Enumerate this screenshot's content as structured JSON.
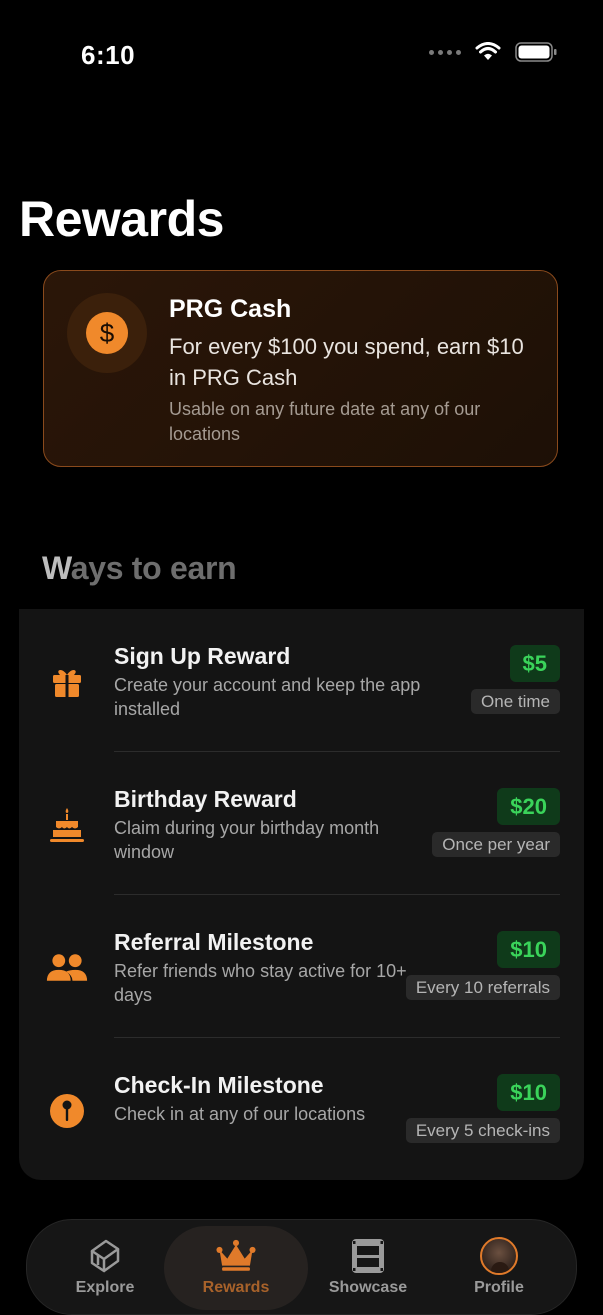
{
  "status_bar": {
    "time": "6:10"
  },
  "page": {
    "title": "Rewards"
  },
  "cash_card": {
    "coin_symbol": "$",
    "title": "PRG Cash",
    "description": "For every $100 you spend, earn $10 in PRG Cash",
    "note": "Usable on any future date at any of our locations"
  },
  "ways_to_earn": {
    "heading_first_letter": "W",
    "heading_rest": "ays to earn",
    "items": [
      {
        "icon": "gift-icon",
        "title": "Sign Up Reward",
        "description": "Create your account and keep the app installed",
        "amount": "$5",
        "frequency": "One time"
      },
      {
        "icon": "cake-icon",
        "title": "Birthday Reward",
        "description": "Claim during your birthday month window",
        "amount": "$20",
        "frequency": "Once per year"
      },
      {
        "icon": "people-icon",
        "title": "Referral Milestone",
        "description": "Refer friends who stay active for 10+ days",
        "amount": "$10",
        "frequency": "Every 10 referrals"
      },
      {
        "icon": "pin-icon",
        "title": "Check-In Milestone",
        "description": "Check in at any of our locations",
        "amount": "$10",
        "frequency": "Every 5 check-ins"
      }
    ]
  },
  "tab_bar": {
    "tabs": [
      {
        "label": "Explore",
        "icon": "layers-icon",
        "active": false
      },
      {
        "label": "Rewards",
        "icon": "crown-icon",
        "active": true
      },
      {
        "label": "Showcase",
        "icon": "film-icon",
        "active": false
      },
      {
        "label": "Profile",
        "icon": "avatar",
        "active": false
      }
    ]
  },
  "colors": {
    "accent": "#f0892b",
    "amount_green": "#3ad35a",
    "background": "#000000"
  }
}
